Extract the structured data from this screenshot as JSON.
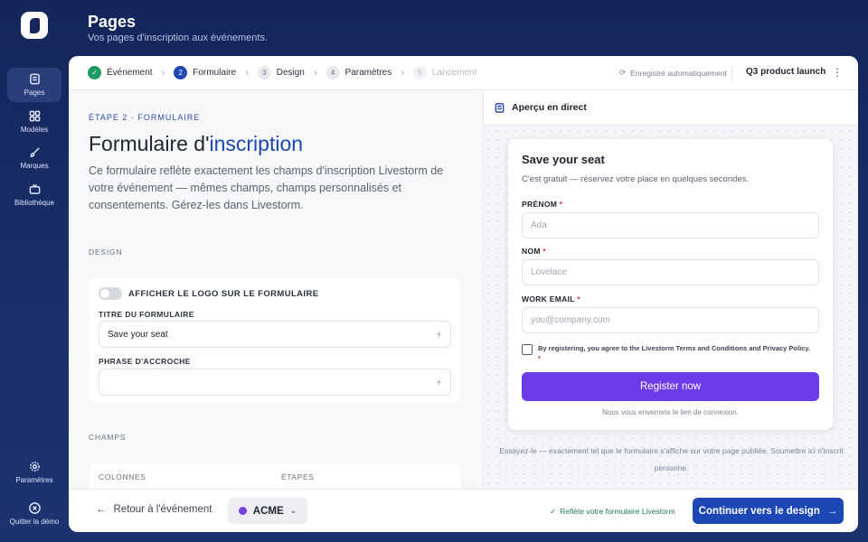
{
  "header": {
    "title": "Pages",
    "subtitle": "Vos pages d'inscription aux événements."
  },
  "sidebar": {
    "items": [
      {
        "label": "Pages",
        "icon": "pages-icon",
        "active": true
      },
      {
        "label": "Modèles",
        "icon": "grid-icon"
      },
      {
        "label": "Marques",
        "icon": "brush-icon"
      },
      {
        "label": "Bibliothèque",
        "icon": "tv-icon"
      }
    ],
    "bottom": [
      {
        "label": "Paramètres",
        "icon": "gear-icon"
      },
      {
        "label": "Quitter la démo",
        "icon": "exit-icon"
      }
    ]
  },
  "stepper": {
    "steps": [
      {
        "num": "✓",
        "label": "Événement",
        "state": "done"
      },
      {
        "num": "2",
        "label": "Formulaire",
        "state": "current"
      },
      {
        "num": "3",
        "label": "Design",
        "state": "todo"
      },
      {
        "num": "4",
        "label": "Paramètres",
        "state": "todo"
      },
      {
        "num": "5",
        "label": "Lancement",
        "state": "disabled"
      }
    ],
    "autosave": "Enregistré automatiquement",
    "event_name": "Q3 product launch"
  },
  "editor": {
    "eyebrow": "ÉTAPE 2 · FORMULAIRE",
    "title_plain": "Formulaire d'",
    "title_highlight": "inscription",
    "description": "Ce formulaire reflète exactement les champs d'inscription Livestorm de votre événement — mêmes champs, champs personnalisés et consentements. Gérez-les dans Livestorm.",
    "design_heading": "DESIGN",
    "show_logo_label": "AFFICHER LE LOGO SUR LE FORMULAIRE",
    "form_title_label": "TITRE DU FORMULAIRE",
    "form_title_value": "Save your seat",
    "tagline_label": "PHRASE D'ACCROCHE",
    "tagline_value": "",
    "fields_heading": "CHAMPS",
    "col_columns": "COLONNES",
    "col_steps": "ÉTAPES"
  },
  "preview": {
    "heading": "Aperçu en direct",
    "form_title": "Save your seat",
    "form_subtitle": "C'est gratuit — réservez votre place en quelques secondes.",
    "fields": [
      {
        "label": "PRÉNOM",
        "placeholder": "Ada"
      },
      {
        "label": "NOM",
        "placeholder": "Lovelace"
      },
      {
        "label": "WORK EMAIL",
        "placeholder": "you@company.com"
      }
    ],
    "required_mark": "*",
    "consent": "By registering, you agree to the Livestorm Terms and Conditions and Privacy Policy.",
    "register_label": "Register now",
    "note": "Nous vous enverrons le lien de connexion.",
    "hint": "Essayez-le — exactement tel que le formulaire s'affiche sur votre page publiée. Soumettre ici n'inscrit personne."
  },
  "footer": {
    "back_label": "Retour à l'événement",
    "brand_label": "ACME",
    "reflect_label": "Reflète votre formulaire Livestorm",
    "continue_label": "Continuer vers le design"
  },
  "colors": {
    "primary": "#1c47b4",
    "register": "#6d3be8",
    "brand_dot": "#7a3fe0",
    "success": "#1f9a62"
  }
}
